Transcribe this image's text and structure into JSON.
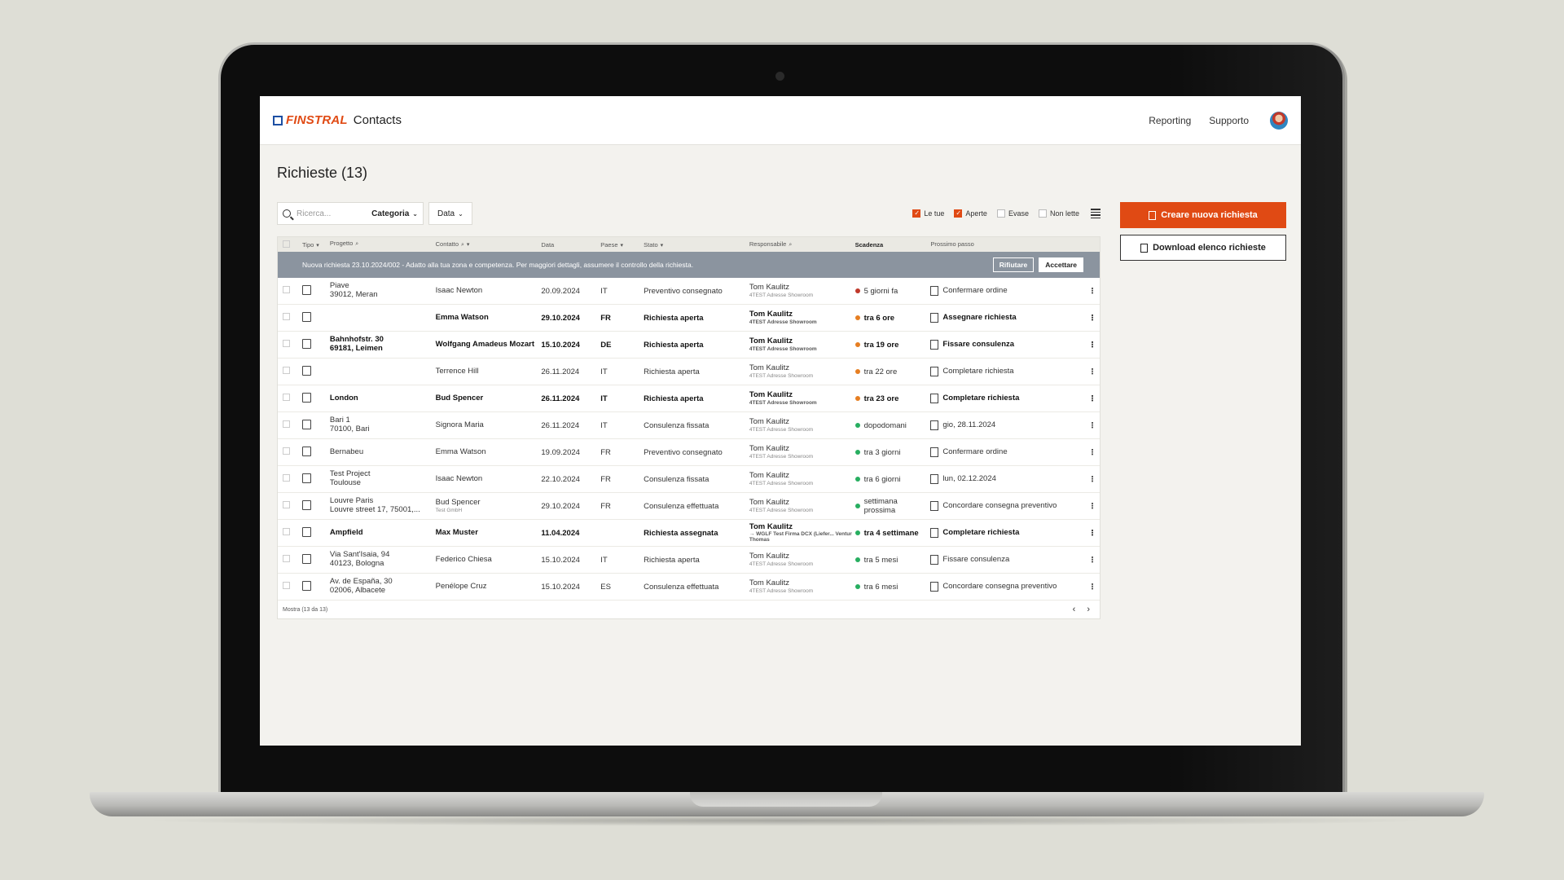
{
  "colors": {
    "accent": "#e04a14",
    "brand_blue": "#1d4fa3",
    "banner_bg": "#8b949f",
    "dot_red": "#c0392b",
    "dot_orange": "#e67e22",
    "dot_green": "#27ae60"
  },
  "header": {
    "brand": "FINSTRAL",
    "app": "Contacts",
    "nav": [
      "Reporting",
      "Supporto"
    ]
  },
  "page": {
    "title": "Richieste (13)"
  },
  "filters": {
    "search_placeholder": "Ricerca...",
    "category_label": "Categoria",
    "date_label": "Data",
    "checkboxes": [
      {
        "label": "Le tue",
        "checked": true
      },
      {
        "label": "Aperte",
        "checked": true
      },
      {
        "label": "Evase",
        "checked": false
      },
      {
        "label": "Non lette",
        "checked": false
      }
    ]
  },
  "actions": {
    "create": "Creare nuova richiesta",
    "download": "Download elenco richieste"
  },
  "table": {
    "headers": [
      "Tipo",
      "Progetto",
      "Contatto",
      "Data",
      "Paese",
      "Stato",
      "Responsabile",
      "Scadenza",
      "Prossimo passo"
    ],
    "banner": {
      "text": "Nuova richiesta 23.10.2024/002 - Adatto alla tua zona e competenza. Per maggiori dettagli, assumere il controllo della richiesta.",
      "reject": "Rifiutare",
      "accept": "Accettare"
    },
    "rows": [
      {
        "bold": false,
        "project": [
          "Piave",
          "39012, Meran"
        ],
        "contact": "Isaac Newton",
        "contact_sub": "",
        "date": "20.09.2024",
        "country": "IT",
        "status": "Preventivo consegnato",
        "owner": "Tom Kaulitz",
        "owner_sub": "4TEST Adresse Showroom",
        "due": "5 giorni fa",
        "due_color": "red",
        "next": "Confermare ordine"
      },
      {
        "bold": true,
        "project": [
          ""
        ],
        "contact": "Emma Watson",
        "contact_sub": "",
        "date": "29.10.2024",
        "country": "FR",
        "status": "Richiesta aperta",
        "owner": "Tom Kaulitz",
        "owner_sub": "4TEST Adresse Showroom",
        "due": "tra 6 ore",
        "due_color": "orange",
        "next": "Assegnare richiesta"
      },
      {
        "bold": true,
        "project": [
          "Bahnhofstr. 30",
          "69181, Leimen"
        ],
        "contact": "Wolfgang Amadeus Mozart",
        "contact_sub": "",
        "date": "15.10.2024",
        "country": "DE",
        "status": "Richiesta aperta",
        "owner": "Tom Kaulitz",
        "owner_sub": "4TEST Adresse Showroom",
        "due": "tra 19 ore",
        "due_color": "orange",
        "next": "Fissare consulenza"
      },
      {
        "bold": false,
        "project": [
          ""
        ],
        "contact": "Terrence Hill",
        "contact_sub": "",
        "date": "26.11.2024",
        "country": "IT",
        "status": "Richiesta aperta",
        "owner": "Tom Kaulitz",
        "owner_sub": "4TEST Adresse Showroom",
        "due": "tra 22 ore",
        "due_color": "orange",
        "next": "Completare richiesta"
      },
      {
        "bold": true,
        "project": [
          "London"
        ],
        "contact": "Bud Spencer",
        "contact_sub": "",
        "date": "26.11.2024",
        "country": "IT",
        "status": "Richiesta aperta",
        "owner": "Tom Kaulitz",
        "owner_sub": "4TEST Adresse Showroom",
        "due": "tra 23 ore",
        "due_color": "orange",
        "next": "Completare richiesta"
      },
      {
        "bold": false,
        "project": [
          "Bari 1",
          "70100, Bari"
        ],
        "contact": "Signora Maria",
        "contact_sub": "",
        "date": "26.11.2024",
        "country": "IT",
        "status": "Consulenza fissata",
        "owner": "Tom Kaulitz",
        "owner_sub": "4TEST Adresse Showroom",
        "due": "dopodomani",
        "due_color": "green",
        "next": "gio, 28.11.2024"
      },
      {
        "bold": false,
        "project": [
          "Bernabeu"
        ],
        "contact": "Emma Watson",
        "contact_sub": "",
        "date": "19.09.2024",
        "country": "FR",
        "status": "Preventivo consegnato",
        "owner": "Tom Kaulitz",
        "owner_sub": "4TEST Adresse Showroom",
        "due": "tra 3 giorni",
        "due_color": "green",
        "next": "Confermare ordine"
      },
      {
        "bold": false,
        "project": [
          "Test Project",
          "Toulouse"
        ],
        "contact": "Isaac Newton",
        "contact_sub": "",
        "date": "22.10.2024",
        "country": "FR",
        "status": "Consulenza fissata",
        "owner": "Tom Kaulitz",
        "owner_sub": "4TEST Adresse Showroom",
        "due": "tra 6 giorni",
        "due_color": "green",
        "next": "lun, 02.12.2024"
      },
      {
        "bold": false,
        "project": [
          "Louvre Paris",
          "Louvre street 17, 75001,..."
        ],
        "contact": "Bud Spencer",
        "contact_sub": "Test GmbH",
        "date": "29.10.2024",
        "country": "FR",
        "status": "Consulenza effettuata",
        "owner": "Tom Kaulitz",
        "owner_sub": "4TEST Adresse Showroom",
        "due": "settimana prossima",
        "due_color": "green",
        "next": "Concordare consegna preventivo"
      },
      {
        "bold": true,
        "project": [
          "Ampfield"
        ],
        "contact": "Max Muster",
        "contact_sub": "",
        "date": "11.04.2024",
        "country": "",
        "status": "Richiesta assegnata",
        "owner": "Tom Kaulitz",
        "owner_sub": "→ WGLF Test Firma DCX (Liefer... Ventur Thomas",
        "due": "tra 4 settimane",
        "due_color": "green",
        "next": "Completare richiesta"
      },
      {
        "bold": false,
        "project": [
          "Via Sant'Isaia, 94",
          "40123, Bologna"
        ],
        "contact": "Federico Chiesa",
        "contact_sub": "",
        "date": "15.10.2024",
        "country": "IT",
        "status": "Richiesta aperta",
        "owner": "Tom Kaulitz",
        "owner_sub": "4TEST Adresse Showroom",
        "due": "tra 5 mesi",
        "due_color": "green",
        "next": "Fissare consulenza"
      },
      {
        "bold": false,
        "project": [
          "Av. de España, 30",
          "02006, Albacete"
        ],
        "contact": "Penélope Cruz",
        "contact_sub": "",
        "date": "15.10.2024",
        "country": "ES",
        "status": "Consulenza effettuata",
        "owner": "Tom Kaulitz",
        "owner_sub": "4TEST Adresse Showroom",
        "due": "tra 6 mesi",
        "due_color": "green",
        "next": "Concordare consegna preventivo"
      }
    ],
    "footer": "Mostra   (13 da 13)"
  }
}
